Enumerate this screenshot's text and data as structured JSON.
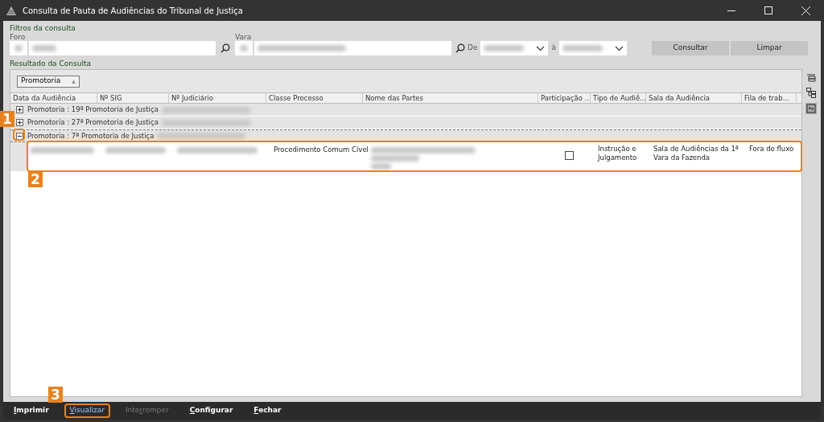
{
  "window": {
    "title": "Consulta de Pauta de Audiências do Tribunal de Justiça"
  },
  "filters": {
    "title": "Filtros da consulta",
    "foro_label": "Foro",
    "vara_label": "Vara",
    "de_label": "De",
    "a_label": "à",
    "buttons": [
      "Consultar",
      "Limpar"
    ]
  },
  "result": {
    "title": "Resultado da Consulta",
    "group_chip": "Promotoria",
    "columns": [
      "Data da Audiência",
      "Nº SIG",
      "Nº Judiciário",
      "Classe Processo",
      "Nome das Partes",
      "Participação ...",
      "Tipo de Audiê...",
      "Sala da Audiência",
      "Fila de trab..."
    ],
    "groups": [
      {
        "label": "Promotoria : 19ª Promotoria de Justiça",
        "expanded": false
      },
      {
        "label": "Promotoria : 27ª Promotoria de Justiça",
        "expanded": false
      },
      {
        "label": "Promotoria : 7ª Promotoria de Justiça",
        "expanded": true,
        "rows": [
          {
            "classe": "Procedimento Comum Cível",
            "participacao": false,
            "tipo": "Instrução e Julgamento",
            "sala": "Sala de Audiências da 1ª Vara da Fazenda",
            "fila": "Fora do fluxo"
          }
        ]
      }
    ]
  },
  "callouts": [
    "1",
    "2",
    "3"
  ],
  "footer": [
    {
      "accel": "I",
      "after": "mprimir",
      "disabled": false,
      "selected": false
    },
    {
      "accel": "V",
      "after": "isualizar",
      "disabled": false,
      "selected": true
    },
    {
      "before": "Inte",
      "accel": "r",
      "after": "romper",
      "disabled": true,
      "selected": false
    },
    {
      "accel": "C",
      "after": "onfigurar",
      "disabled": false,
      "selected": false
    },
    {
      "accel": "F",
      "after": "echar",
      "disabled": false,
      "selected": false
    }
  ]
}
